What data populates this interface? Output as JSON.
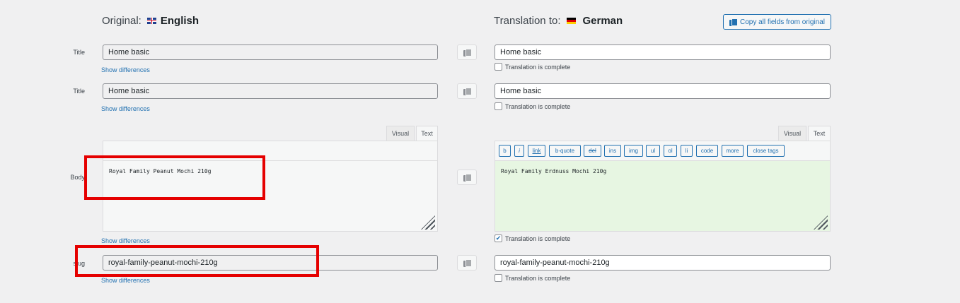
{
  "header": {
    "original_label": "Original:",
    "original_lang": "English",
    "translation_label": "Translation to:",
    "translation_lang": "German",
    "copy_all_label": "Copy all fields from original"
  },
  "rows": [
    {
      "label": "Title",
      "original": "Home basic",
      "translation": "Home basic",
      "show_diff": "Show differences",
      "complete_label": "Translation is complete",
      "complete": false
    },
    {
      "label": "Title",
      "original": "Home basic",
      "translation": "Home basic",
      "show_diff": "Show differences",
      "complete_label": "Translation is complete",
      "complete": false
    },
    {
      "label": "Body",
      "original": "Royal Family Peanut Mochi 210g",
      "translation": "Royal Family Erdnuss Mochi 210g",
      "show_diff": "Show differences",
      "complete_label": "Translation is complete",
      "complete": true
    },
    {
      "label": "slug",
      "original": "royal-family-peanut-mochi-210g",
      "translation": "royal-family-peanut-mochi-210g",
      "show_diff": "Show differences",
      "complete_label": "Translation is complete",
      "complete": false
    }
  ],
  "editor": {
    "tab_visual": "Visual",
    "tab_text": "Text",
    "quicktags": [
      "b",
      "i",
      "link",
      "b-quote",
      "del",
      "ins",
      "img",
      "ul",
      "ol",
      "li",
      "code",
      "more",
      "close tags"
    ]
  },
  "colors": {
    "accent": "#2271b1",
    "highlight": "#e50000",
    "translated_bg": "#e7f6e2",
    "page_bg": "#f0f0f1"
  }
}
